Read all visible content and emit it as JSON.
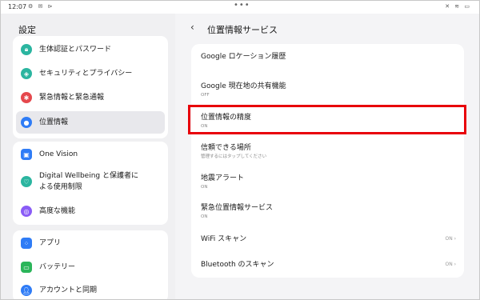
{
  "status_bar": {
    "time": "12:07",
    "left_icons": "⚙ ✉ ⊳",
    "center_dots": "•••",
    "right_icons": "✕ ≋ ▭"
  },
  "left": {
    "title": "設定",
    "groups": [
      [
        {
          "label": "生体認証とパスワード",
          "icon": "lock-icon",
          "color": "#2bb5a0"
        },
        {
          "label": "セキュリティとプライバシー",
          "icon": "shield-icon",
          "color": "#2bb5a0"
        },
        {
          "label": "緊急情報と緊急通報",
          "icon": "asterisk-icon",
          "color": "#e5484d"
        },
        {
          "label": "位置情報",
          "icon": "location-pin-icon",
          "color": "#2f7cf6"
        }
      ],
      [
        {
          "label": "One Vision",
          "icon": "vision-icon",
          "color": "#2f7cf6"
        },
        {
          "label": "Digital Wellbeing と保護者に",
          "label2": "よる使用制限",
          "icon": "wellbeing-icon",
          "color": "#2bb5a0"
        },
        {
          "label": "高度な機能",
          "icon": "advanced-icon",
          "color": "#8a5cf6"
        }
      ],
      [
        {
          "label": "アプリ",
          "icon": "apps-icon",
          "color": "#2f7cf6"
        },
        {
          "label": "バッテリー",
          "icon": "battery-icon",
          "color": "#2bb55a"
        },
        {
          "label": "アカウントと同期",
          "icon": "account-icon",
          "color": "#2f7cf6"
        }
      ]
    ]
  },
  "right": {
    "back": "‹",
    "title": "位置情報サービス",
    "rows": [
      {
        "label": "Google ロケーション履歴",
        "sub": "",
        "value": ""
      },
      {
        "label": "Google 現在地の共有機能",
        "sub": "OFF",
        "value": ""
      },
      {
        "label": "位置情報の精度",
        "sub": "ON",
        "value": ""
      },
      {
        "label": "信頼できる場所",
        "sub": "管理するにはタップしてください",
        "value": ""
      },
      {
        "label": "地震アラート",
        "sub": "ON",
        "value": ""
      },
      {
        "label": "緊急位置情報サービス",
        "sub": "ON",
        "value": ""
      },
      {
        "label": "WiFi スキャン",
        "sub": "",
        "value": "ON ›"
      },
      {
        "label": "Bluetooth のスキャン",
        "sub": "",
        "value": "ON ›"
      }
    ]
  },
  "colors": {
    "highlight": "#e8000a",
    "accent": "#2f7cf6"
  }
}
